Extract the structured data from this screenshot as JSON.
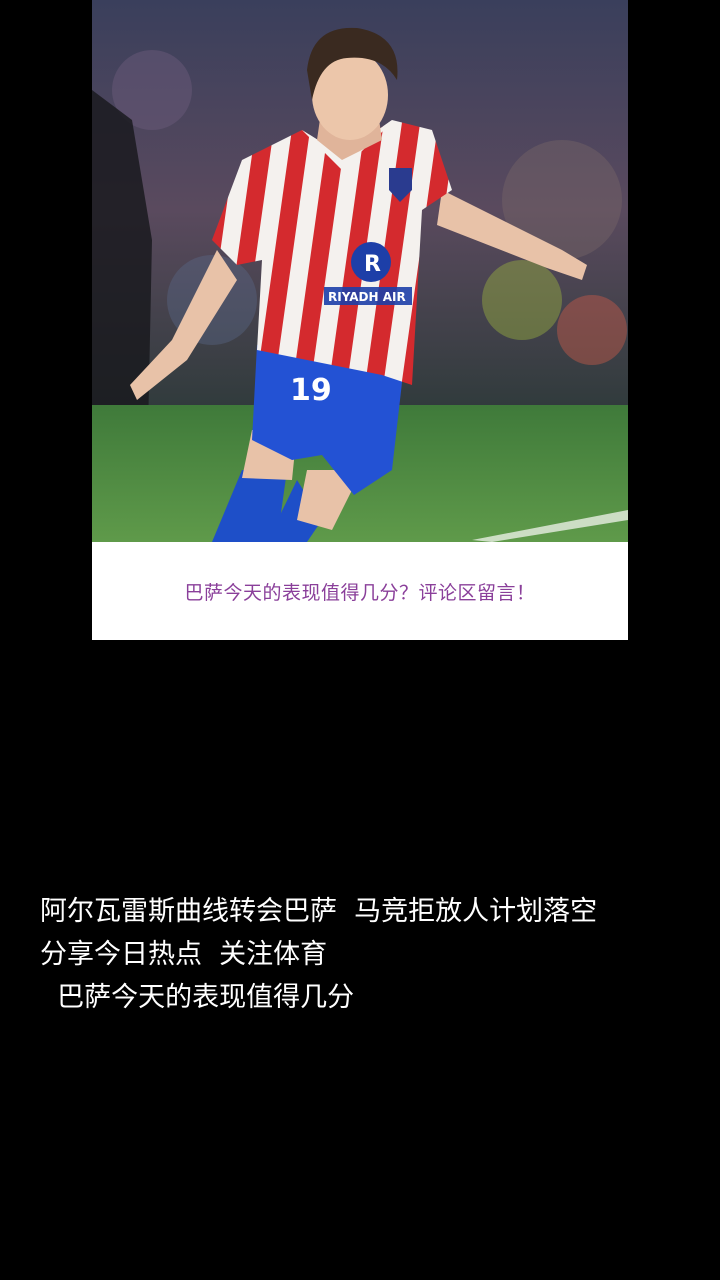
{
  "post": {
    "image_caption": "巴萨今天的表现值得几分？评论区留言！",
    "jersey_number": "19",
    "sponsor_text": "RIYADH AIR"
  },
  "overlay": {
    "line1": "阿尔瓦雷斯曲线转会巴萨  马竞拒放人计划落空",
    "line2": "分享今日热点  关注体育",
    "line3": "  巴萨今天的表现值得几分"
  }
}
